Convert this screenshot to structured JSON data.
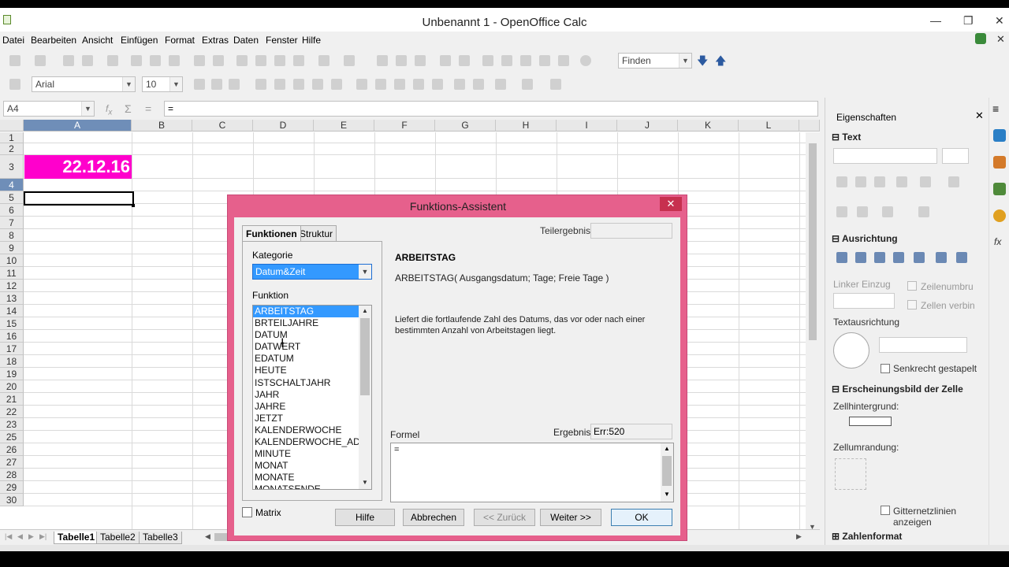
{
  "window": {
    "title": "Unbenannt 1 - OpenOffice Calc"
  },
  "menu": [
    "Datei",
    "Bearbeiten",
    "Ansicht",
    "Einfügen",
    "Format",
    "Extras",
    "Daten",
    "Fenster",
    "Hilfe"
  ],
  "toolbar": {
    "find_placeholder": "Finden",
    "font_name": "Arial",
    "font_size": "10"
  },
  "formula_bar": {
    "name_box": "A4",
    "content": "="
  },
  "columns": [
    "A",
    "B",
    "C",
    "D",
    "E",
    "F",
    "G",
    "H",
    "I",
    "J",
    "K",
    "L"
  ],
  "rows": [
    "1",
    "2",
    "3",
    "4",
    "5",
    "6",
    "7",
    "8",
    "9",
    "10",
    "11",
    "12",
    "13",
    "14",
    "15",
    "16",
    "17",
    "18",
    "19",
    "20",
    "21",
    "22",
    "23",
    "25",
    "26",
    "27",
    "28",
    "29",
    "30"
  ],
  "cell_a2": {
    "value": "22.12.16",
    "fill": "#ff00cc",
    "color": "#ffffff"
  },
  "sheets": [
    "Tabelle1",
    "Tabelle2",
    "Tabelle3"
  ],
  "sidebar": {
    "title": "Eigenschaften",
    "text_section": "Text",
    "alignment_section": "Ausrichtung",
    "indent_label": "Linker Einzug",
    "wrap_label": "Zeilenumbru",
    "merge_label": "Zellen verbin",
    "orientation_label": "Textausrichtung",
    "stacked_label": "Senkrecht gestapelt",
    "appearance_section": "Erscheinungsbild der Zelle",
    "bg_label": "Zellhintergrund:",
    "border_label": "Zellumrandung:",
    "grid_label": "Gitternetzlinien anzeigen",
    "number_section": "Zahlenformat"
  },
  "dialog": {
    "title": "Funktions-Assistent",
    "tab_functions": "Funktionen",
    "tab_structure": "Struktur",
    "category_label": "Kategorie",
    "category_value": "Datum&Zeit",
    "function_label": "Funktion",
    "functions": [
      "ARBEITSTAG",
      "BRTEILJAHRE",
      "DATUM",
      "DATWERT",
      "EDATUM",
      "HEUTE",
      "ISTSCHALTJAHR",
      "JAHR",
      "JAHRE",
      "JETZT",
      "KALENDERWOCHE",
      "KALENDERWOCHE_ADD",
      "MINUTE",
      "MONAT",
      "MONATE",
      "MONATSENDE"
    ],
    "partial_result_label": "Teilergebnis",
    "func_name": "ARBEITSTAG",
    "func_syntax": "ARBEITSTAG( Ausgangsdatum; Tage; Freie Tage )",
    "func_desc": "Liefert die fortlaufende Zahl des Datums, das vor oder nach einer bestimmten Anzahl von Arbeitstagen liegt.",
    "formula_label": "Formel",
    "result_label": "Ergebnis",
    "result_value": "Err:520",
    "formula_value": "=",
    "matrix_label": "Matrix",
    "btn_help": "Hilfe",
    "btn_cancel": "Abbrechen",
    "btn_back": "<< Zurück",
    "btn_next": "Weiter >>",
    "btn_ok": "OK"
  }
}
